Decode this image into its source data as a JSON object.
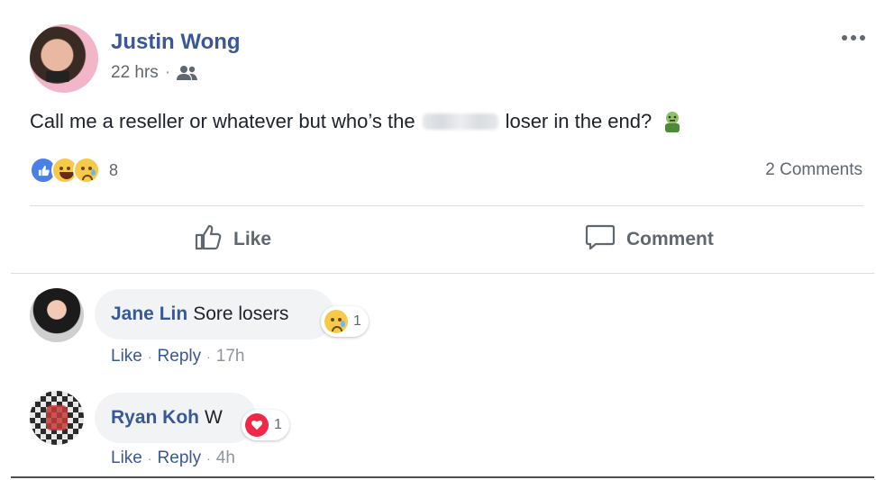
{
  "post": {
    "author": "Justin Wong",
    "time": "22 hrs",
    "separator": "·",
    "audience_icon": "friends-icon",
    "more_icon": "more-options-icon",
    "text_before": "Call me a reseller or whatever but who’s the",
    "text_after": "loser in the end?",
    "trailing_emoji": "zombie-emoji",
    "reaction_icons": [
      "like-reaction-icon",
      "haha-reaction-icon",
      "sad-reaction-icon"
    ],
    "reaction_count": "8",
    "comments_count": "2 Comments"
  },
  "actions": {
    "like_label": "Like",
    "comment_label": "Comment"
  },
  "comments": [
    {
      "name": "Jane Lin",
      "text": "Sore losers",
      "reaction_icon": "sad-reaction-icon",
      "reaction_count": "1",
      "like": "Like",
      "reply": "Reply",
      "time": "17h",
      "separator": "·"
    },
    {
      "name": "Ryan Koh",
      "text": "W",
      "reaction_icon": "love-reaction-icon",
      "reaction_count": "1",
      "like": "Like",
      "reply": "Reply",
      "time": "4h",
      "separator": "·"
    }
  ],
  "colors": {
    "name_link": "#385898",
    "meta_gray": "#616770",
    "bubble_bg": "#f2f3f5",
    "like_blue": "#4a7fe8",
    "love_red": "#f0284a",
    "emoji_yellow": "#f7c94a"
  }
}
